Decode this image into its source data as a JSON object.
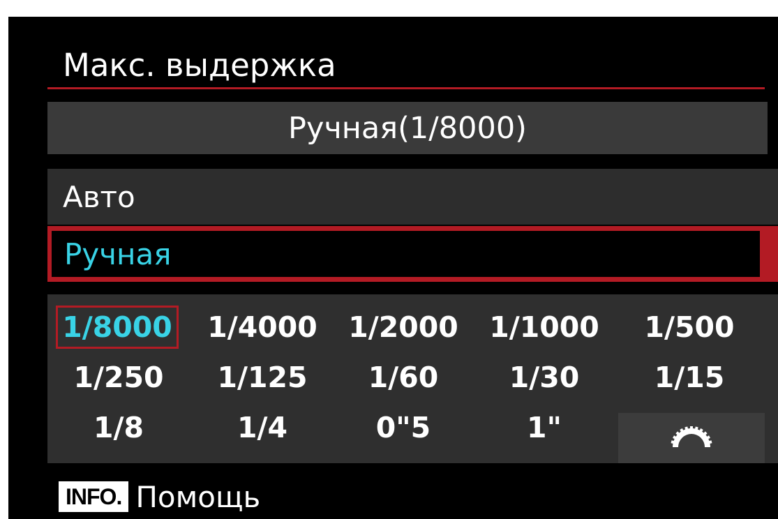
{
  "header": {
    "title": "Макс. выдержка",
    "current_value": "Ручная(1/8000)"
  },
  "options": [
    {
      "label": "Авто",
      "selected": false
    },
    {
      "label": "Ручная",
      "selected": true
    }
  ],
  "shutter_values": [
    [
      "1/8000",
      "1/4000",
      "1/2000",
      "1/1000",
      "1/500"
    ],
    [
      "1/250",
      "1/125",
      "1/60",
      "1/30",
      "1/15"
    ],
    [
      "1/8",
      "1/4",
      "0\"5",
      "1\""
    ]
  ],
  "selected_value": "1/8000",
  "dial_icon": "main-dial-icon",
  "footer": {
    "info_label": "INFO.",
    "help_label": "Помощь"
  },
  "colors": {
    "accent_red": "#b31b24",
    "highlight_cyan": "#39d3e6",
    "background": "#000000",
    "panel_gray": "#2f2f2f"
  }
}
